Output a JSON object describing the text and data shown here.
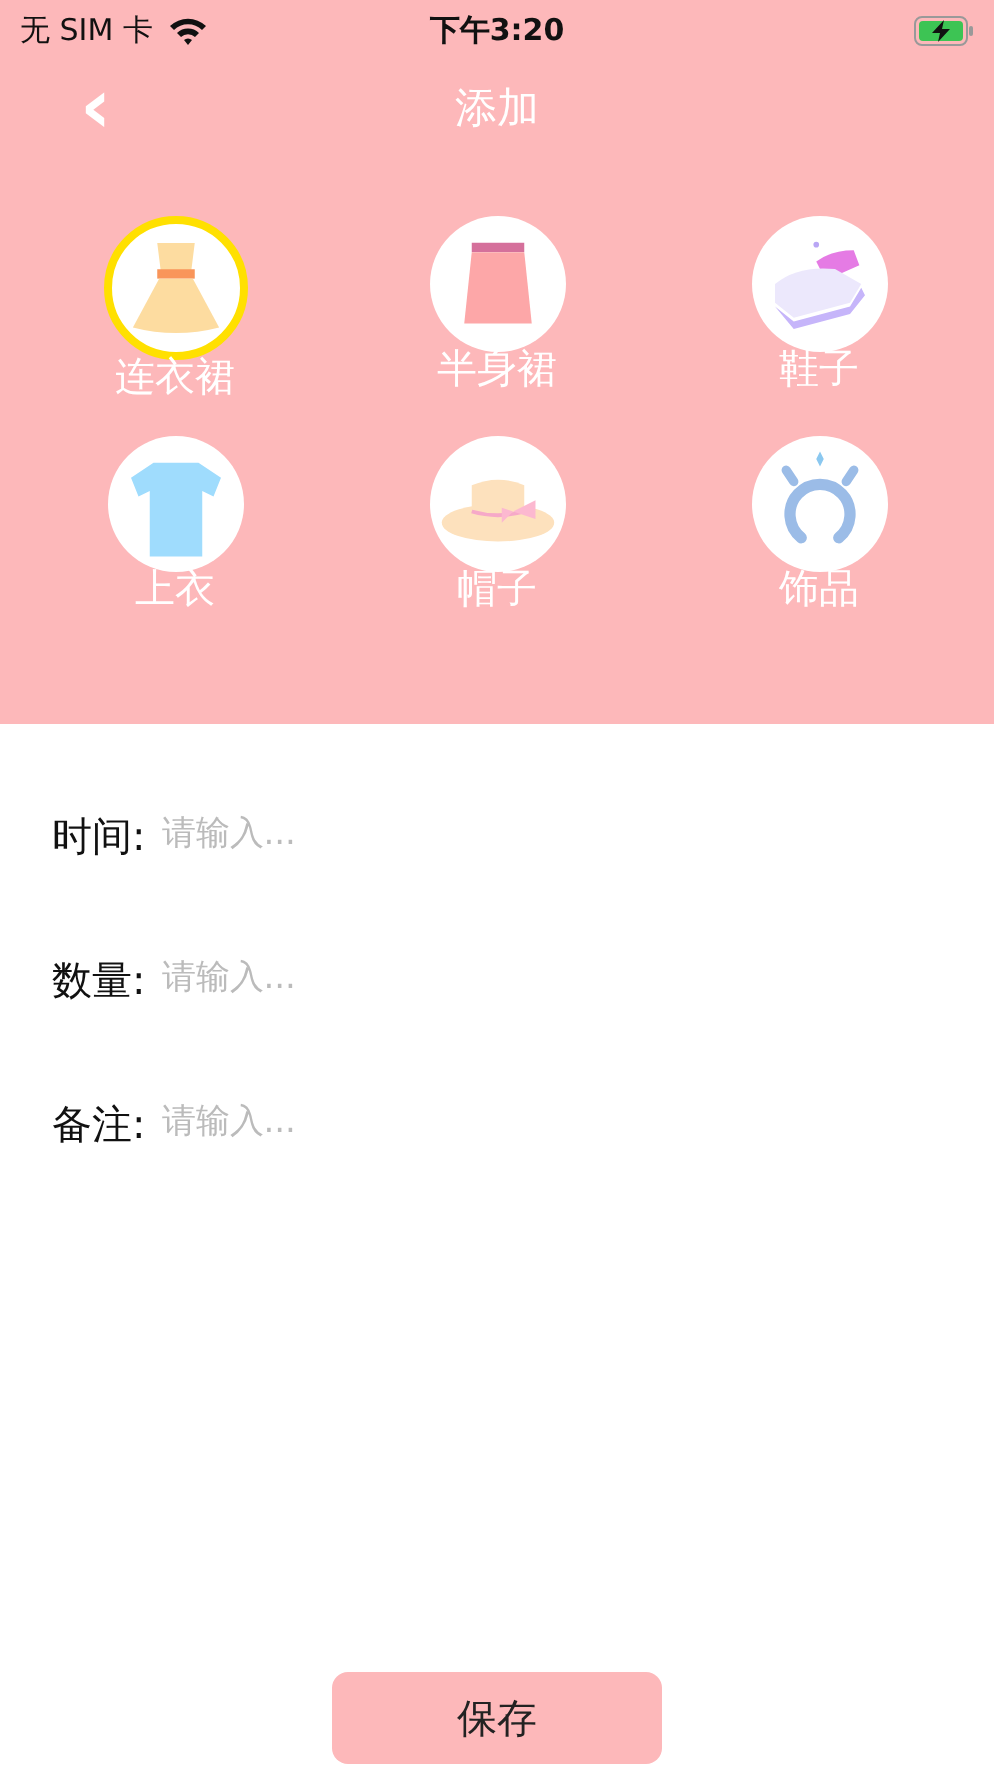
{
  "status_bar": {
    "carrier": "无 SIM 卡",
    "time": "下午3:20"
  },
  "nav": {
    "back": "‹",
    "title": "添加"
  },
  "categories": [
    {
      "kind": "dress",
      "label": "连衣裙",
      "selected": true
    },
    {
      "kind": "skirt",
      "label": "半身裙",
      "selected": false
    },
    {
      "kind": "shoes",
      "label": "鞋子",
      "selected": false
    },
    {
      "kind": "shirt",
      "label": "上衣",
      "selected": false
    },
    {
      "kind": "hat",
      "label": "帽子",
      "selected": false
    },
    {
      "kind": "accessory",
      "label": "饰品",
      "selected": false
    }
  ],
  "fields": [
    {
      "label": "时间:",
      "placeholder": "请输入..."
    },
    {
      "label": "数量:",
      "placeholder": "请输入..."
    },
    {
      "label": "备注:",
      "placeholder": "请输入..."
    }
  ],
  "save_button": "保存"
}
